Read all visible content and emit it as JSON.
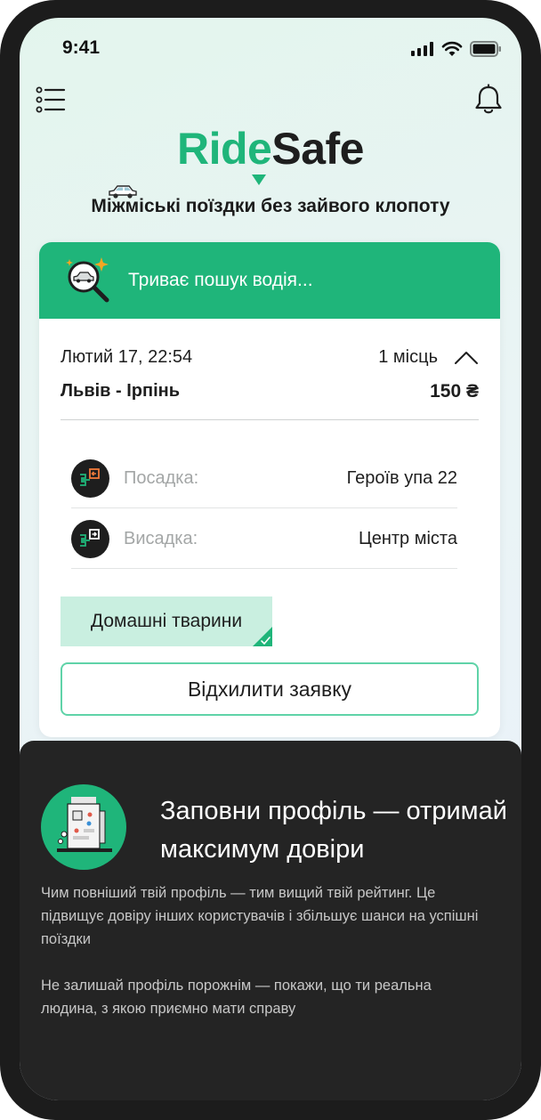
{
  "status_bar": {
    "time": "9:41"
  },
  "header": {
    "logo_ride": "Rid",
    "logo_e": "e",
    "logo_s": "S",
    "logo_afe": "afe",
    "tagline": "Міжміські поїздки без зайвого клопоту"
  },
  "card": {
    "status_text": "Триває пошук водія...",
    "date": "Лютий 17, 22:54",
    "seats": "1 місць",
    "route": "Львів - Ірпінь",
    "price": "150 ₴",
    "pickup": {
      "label": "Посадка:",
      "value": "Героїв упа 22"
    },
    "dropoff": {
      "label": "Висадка:",
      "value": "Центр міста"
    },
    "tag": "Домашні тварини",
    "decline_label": "Відхилити заявку"
  },
  "sheet": {
    "title": "Заповни профіль — отримай максимум довіри",
    "paragraph1": "Чим повніший твій профіль — тим вищий твій рейтинг. Це підвищує довіру інших користувачів і збільшує шанси на успішні поїздки",
    "paragraph2": "Не залишай профіль порожнім — покажи, що ти реальна людина, з якою приємно мати справу"
  },
  "colors": {
    "brand_green": "#1fb57a",
    "dark": "#1e1e1e",
    "chip_bg": "#c9efe0",
    "sheet_bg": "#242424"
  },
  "icons": [
    "signal-icon",
    "wifi-icon",
    "battery-icon",
    "menu-icon",
    "bell-icon",
    "car-icon",
    "search-car-icon",
    "chevron-up-icon",
    "pickup-icon",
    "dropoff-icon",
    "check-icon",
    "profile-illustration-icon"
  ]
}
